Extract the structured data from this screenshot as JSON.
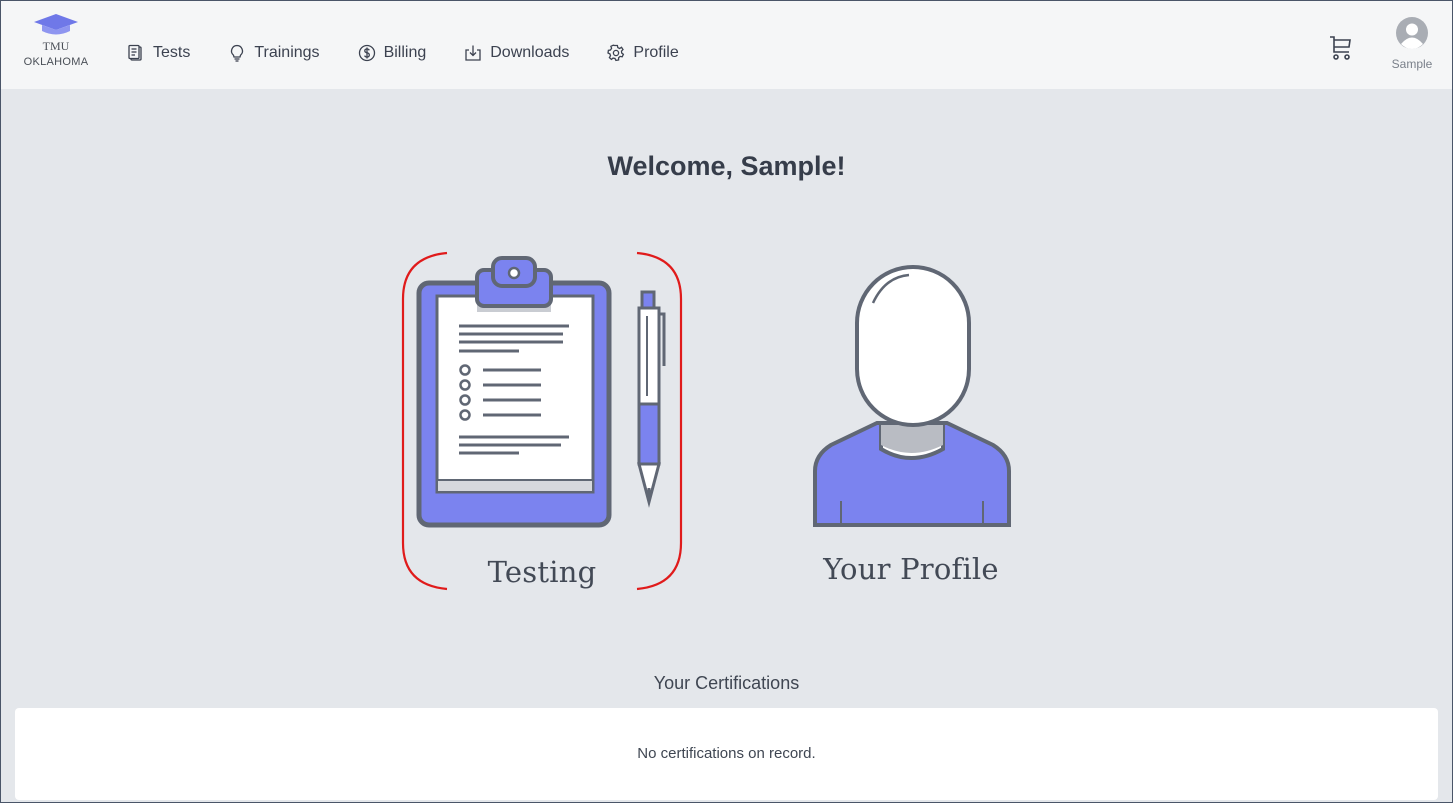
{
  "brand": {
    "name": "TMU",
    "subtitle": "OKLAHOMA",
    "accent": "#7b83ef"
  },
  "nav": [
    {
      "label": "Tests",
      "icon": "clipboard-icon"
    },
    {
      "label": "Trainings",
      "icon": "lightbulb-icon"
    },
    {
      "label": "Billing",
      "icon": "dollar-circle-icon"
    },
    {
      "label": "Downloads",
      "icon": "download-icon"
    },
    {
      "label": "Profile",
      "icon": "gear-icon"
    }
  ],
  "user": {
    "name": "Sample",
    "icon": "avatar-icon"
  },
  "cart": {
    "icon": "cart-icon"
  },
  "main": {
    "welcome": "Welcome, Sample!",
    "cards": [
      {
        "label": "Testing",
        "icon": "clipboard-illustration"
      },
      {
        "label": "Your Profile",
        "icon": "person-illustration"
      }
    ],
    "highlight_color": "#e01b1b"
  },
  "certifications": {
    "title": "Your Certifications",
    "empty_message": "No certifications on record."
  }
}
